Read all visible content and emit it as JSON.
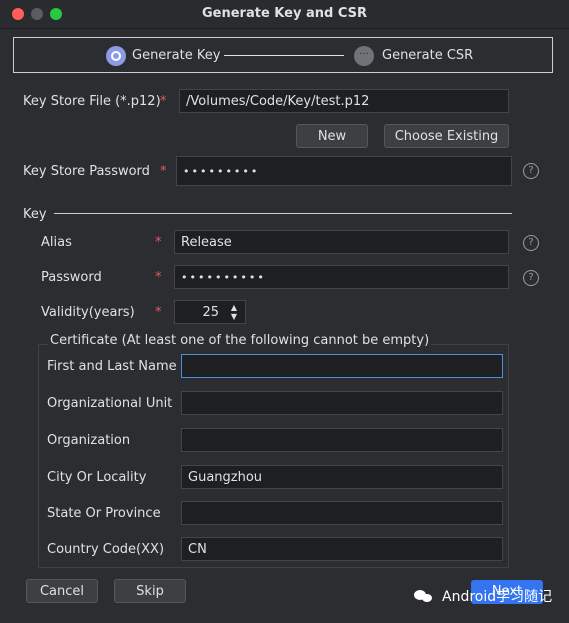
{
  "window": {
    "title": "Generate Key and CSR"
  },
  "stepper": {
    "step1": "Generate Key",
    "step2": "Generate CSR",
    "step2_icon_text": "···"
  },
  "keystore": {
    "file_label": "Key Store File (*.p12)",
    "file_value": "/Volumes/Code/Key/test.p12",
    "new_button": "New",
    "choose_existing_button": "Choose Existing",
    "password_label": "Key Store Password",
    "password_value": "•••••••••"
  },
  "required_mark": "*",
  "help_glyph": "?",
  "key": {
    "section_label": "Key",
    "alias_label": "Alias",
    "alias_value": "Release",
    "password_label": "Password",
    "password_value": "••••••••••",
    "validity_label": "Validity(years)",
    "validity_value": "25"
  },
  "certificate": {
    "title": "Certificate (At least one of the following cannot be empty)",
    "fields": [
      {
        "label": "First and Last Name",
        "value": ""
      },
      {
        "label": "Organizational Unit",
        "value": ""
      },
      {
        "label": "Organization",
        "value": ""
      },
      {
        "label": "City Or Locality",
        "value": "Guangzhou"
      },
      {
        "label": "State Or Province",
        "value": ""
      },
      {
        "label": "Country Code(XX)",
        "value": "CN"
      }
    ]
  },
  "footer": {
    "cancel": "Cancel",
    "skip": "Skip",
    "next": "Next"
  },
  "watermark": {
    "text": "Android学习随记"
  },
  "colors": {
    "accent": "#3574f0",
    "required": "#e55765",
    "step_active": "#8c9ae8"
  }
}
